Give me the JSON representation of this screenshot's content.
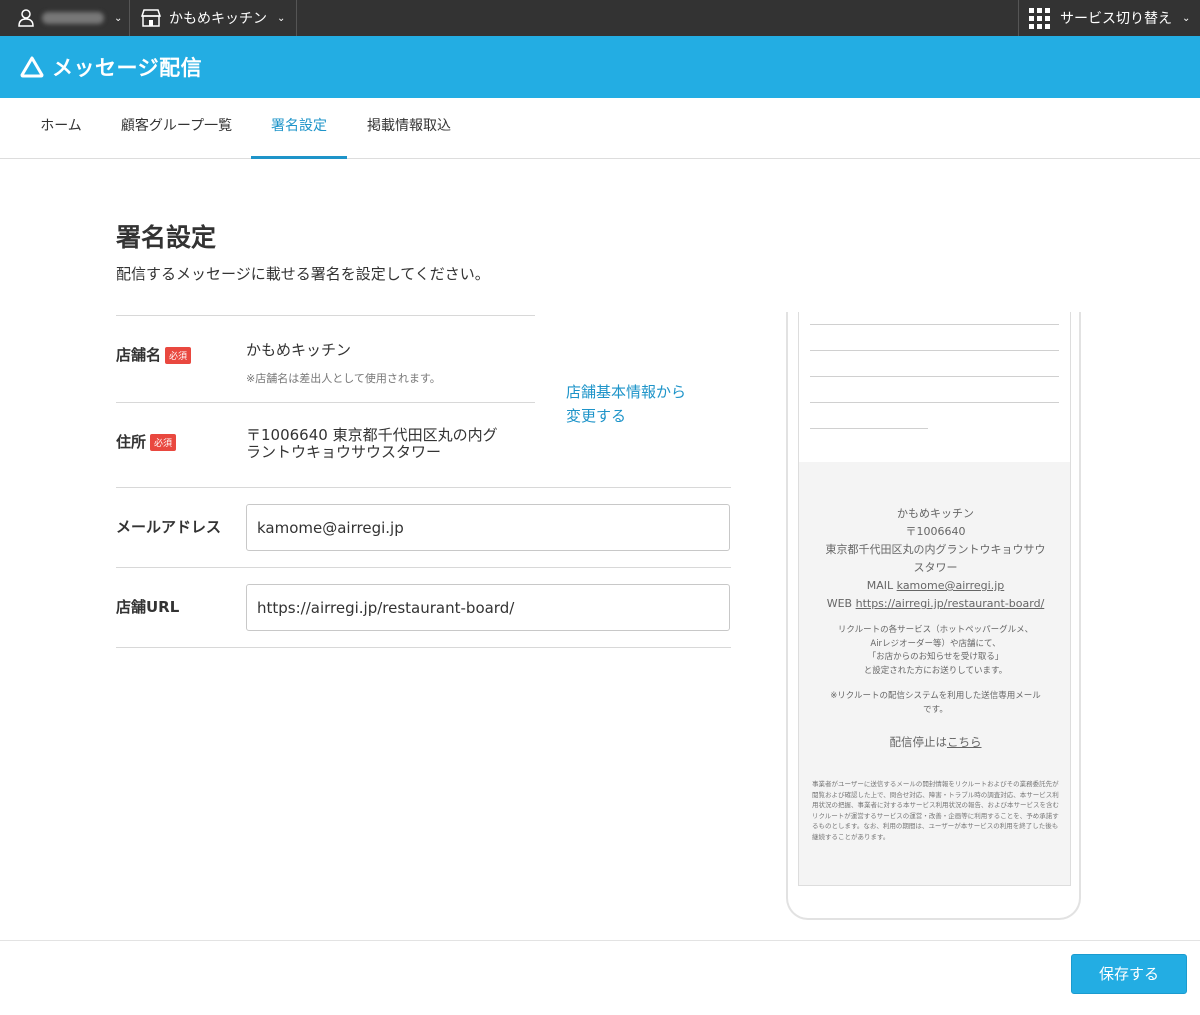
{
  "topbar": {
    "shop_name": "かもめキッチン",
    "service_switch": "サービス切り替え"
  },
  "app": {
    "title": "メッセージ配信"
  },
  "tabs": [
    {
      "label": "ホーム"
    },
    {
      "label": "顧客グループ一覧"
    },
    {
      "label": "署名設定"
    },
    {
      "label": "掲載情報取込"
    }
  ],
  "page": {
    "title": "署名設定",
    "description": "配信するメッセージに載せる署名を設定してください。"
  },
  "form": {
    "required_badge": "必須",
    "store_name_label": "店舗名",
    "store_name_value": "かもめキッチン",
    "store_name_note": "※店舗名は差出人として使用されます。",
    "address_label": "住所",
    "address_line1": "〒1006640 東京都千代田区丸の内グ",
    "address_line2": "ラントウキョウサウスタワー",
    "change_link_line1": "店舗基本情報から",
    "change_link_line2": "変更する",
    "email_label": "メールアドレス",
    "email_value": "kamome@airregi.jp",
    "url_label": "店舗URL",
    "url_value": "https://airregi.jp/restaurant-board/"
  },
  "preview": {
    "store": "かもめキッチン",
    "zip": "〒1006640",
    "addr1": "東京都千代田区丸の内グラントウキョウサウ",
    "addr2": "スタワー",
    "mail_prefix": "MAIL ",
    "mail": "kamome@airregi.jp",
    "web_prefix": "WEB ",
    "web": "https://airregi.jp/restaurant-board/",
    "notice1": "リクルートの各サービス（ホットペッパーグルメ、",
    "notice2": "Airレジオーダー等）や店舗にて、",
    "notice3": "「お店からのお知らせを受け取る」",
    "notice4": "と設定された方にお送りしています。",
    "notice5": "※リクルートの配信システムを利用した送信専用メール",
    "notice6": "です。",
    "unsub_prefix": "配信停止は",
    "unsub_link": "こちら",
    "fine_print": "事業者がユーザーに送信するメールの開封情報をリクルートおよびその業務委託先が閲覧および確認した上で、問合せ対応、障害・トラブル時の調査対応、本サービス利用状況の把握、事業者に対する本サービス利用状況の報告、および本サービスを含むリクルートが運営するサービスの運営・改善・企画等に利用することを、予め承諾するものとします。なお、利用の期間は、ユーザーが本サービスの利用を終了した後も継続することがあります。"
  },
  "footer": {
    "save_label": "保存する"
  },
  "colors": {
    "brand": "#23ade3",
    "link": "#1e94c9",
    "required": "#e9483f"
  }
}
